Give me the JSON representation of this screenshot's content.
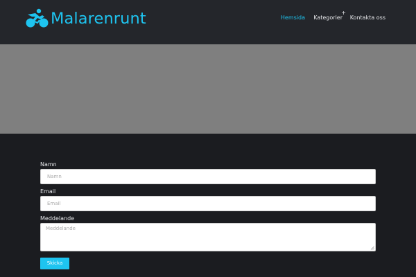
{
  "header": {
    "brand": "Malarenrunt",
    "nav": {
      "home": "Hemsida",
      "categories": "Kategorier",
      "categories_expand": "+",
      "contact": "Kontakta oss"
    }
  },
  "form": {
    "name_label": "Namn",
    "name_placeholder": "Namn",
    "email_label": "Email",
    "email_placeholder": "Email",
    "message_label": "Meddelande",
    "message_placeholder": "Meddelande",
    "submit_label": "Skicka"
  },
  "colors": {
    "accent": "#1ec4f0",
    "header_bg": "#24262b",
    "page_bg": "#1b1c20",
    "banner_bg": "#7f7f7f"
  },
  "icons": {
    "logo": "cyclist-icon",
    "resize": "resize-grip-icon"
  }
}
